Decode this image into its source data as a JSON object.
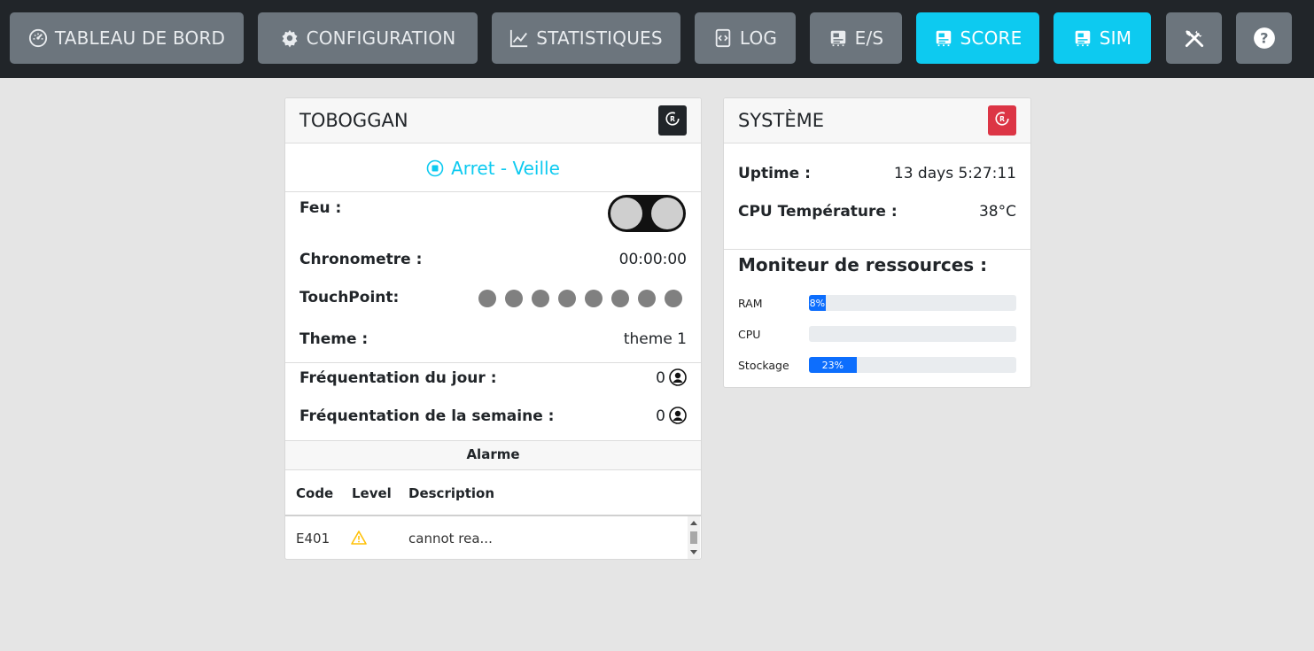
{
  "nav": {
    "dashboard": {
      "label": "TABLEAU DE BORD",
      "icon": "speedometer-icon"
    },
    "config": {
      "label": "CONFIGURATION",
      "icon": "gear-icon"
    },
    "stats": {
      "label": "STATISTIQUES",
      "icon": "line-chart-icon"
    },
    "log": {
      "label": "LOG",
      "icon": "file-code-icon"
    },
    "io": {
      "label": "E/S",
      "icon": "board-icon"
    },
    "score": {
      "label": "SCORE",
      "icon": "board-icon"
    },
    "sim": {
      "label": "SIM",
      "icon": "board-icon"
    },
    "tools": {
      "icon": "tools-icon"
    },
    "help": {
      "icon": "help-icon"
    }
  },
  "colors": {
    "accent": "#0dcaf0",
    "danger": "#dc3545",
    "progress": "#0d6efd",
    "nav_bg": "#212529",
    "nav_btn": "#6c757d"
  },
  "toboggan": {
    "title": "TOBOGGAN",
    "status": "Arret - Veille",
    "feu_label": "Feu :",
    "chrono_label": "Chronometre :",
    "chrono_value": "00:00:00",
    "touchpoint_label": "TouchPoint:",
    "touchpoint_count": 8,
    "theme_label": "Theme :",
    "theme_value": "theme 1",
    "freq_day_label": "Fréquentation du jour :",
    "freq_day_value": "0",
    "freq_week_label": "Fréquentation de la semaine :",
    "freq_week_value": "0"
  },
  "alarm": {
    "title": "Alarme",
    "columns": [
      "Code",
      "Level",
      "Description"
    ],
    "rows": [
      {
        "code": "E401",
        "level": "warning-icon",
        "description": "cannot rea..."
      }
    ]
  },
  "system": {
    "title": "SYSTÈME",
    "uptime_label": "Uptime :",
    "uptime_value": "13 days 5:27:11",
    "cpu_temp_label": "CPU Température :",
    "cpu_temp_value": "38°C",
    "resources_title": "Moniteur de ressources :",
    "resources": [
      {
        "name": "RAM",
        "percent": 8,
        "label": "8%"
      },
      {
        "name": "CPU",
        "percent": 0,
        "label": ""
      },
      {
        "name": "Stockage",
        "percent": 23,
        "label": "23%"
      }
    ]
  }
}
